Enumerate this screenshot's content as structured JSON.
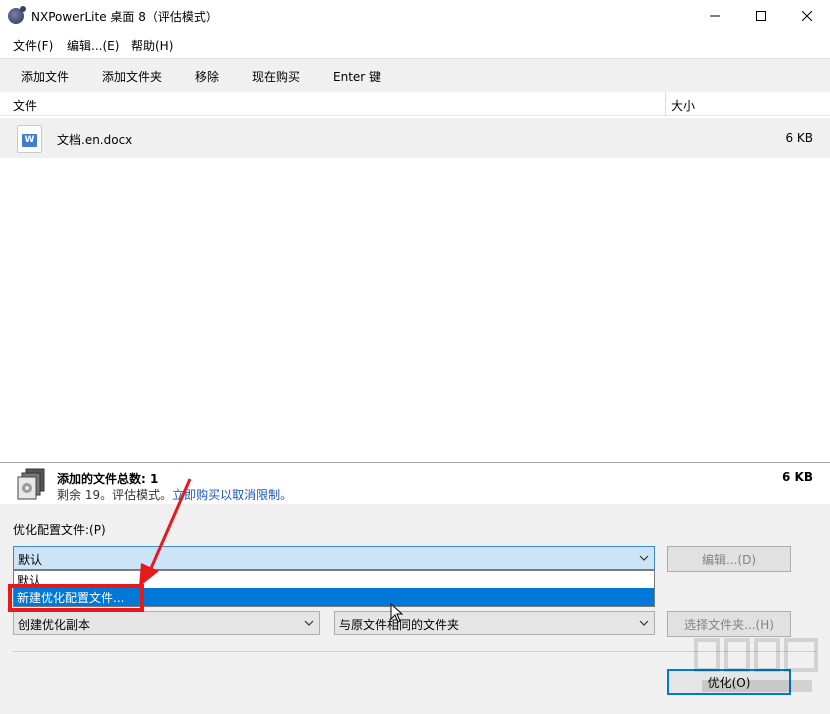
{
  "window": {
    "title": "NXPowerLite 桌面 8（评估模式）",
    "controls": [
      "minimize",
      "maximize",
      "close"
    ]
  },
  "menubar": {
    "file": "文件(F)",
    "edit": "编辑...(E)",
    "help": "帮助(H)"
  },
  "toolbar": {
    "add_file": "添加文件",
    "add_folder": "添加文件夹",
    "remove": "移除",
    "buy_now": "现在购买",
    "enter": "Enter 键"
  },
  "file_list": {
    "columns": {
      "file": "文件",
      "size": "大小"
    },
    "rows": [
      {
        "name": "文档.en.docx",
        "size": "6 KB",
        "icon": "word-document-icon"
      }
    ]
  },
  "summary": {
    "title": "添加的文件总数: 1",
    "remaining_prefix": "剩余 19。评估模式。",
    "buy_link": "立即购买以取消限制。",
    "total_size": "6 KB"
  },
  "options": {
    "profile_label": "优化配置文件:(P)",
    "profile_selected": "默认",
    "profile_options": [
      "默认",
      "新建优化配置文件..."
    ],
    "edit_button": "编辑...(D)",
    "copy_mode": "创建优化副本",
    "location": "与原文件相同的文件夹",
    "choose_folder_button": "选择文件夹...(H)",
    "optimize_button": "优化(O)"
  },
  "colors": {
    "selection": "#0078d7",
    "combo_focus": "#cce4f7",
    "annotation": "#e8191d",
    "link": "#1a56c5"
  }
}
